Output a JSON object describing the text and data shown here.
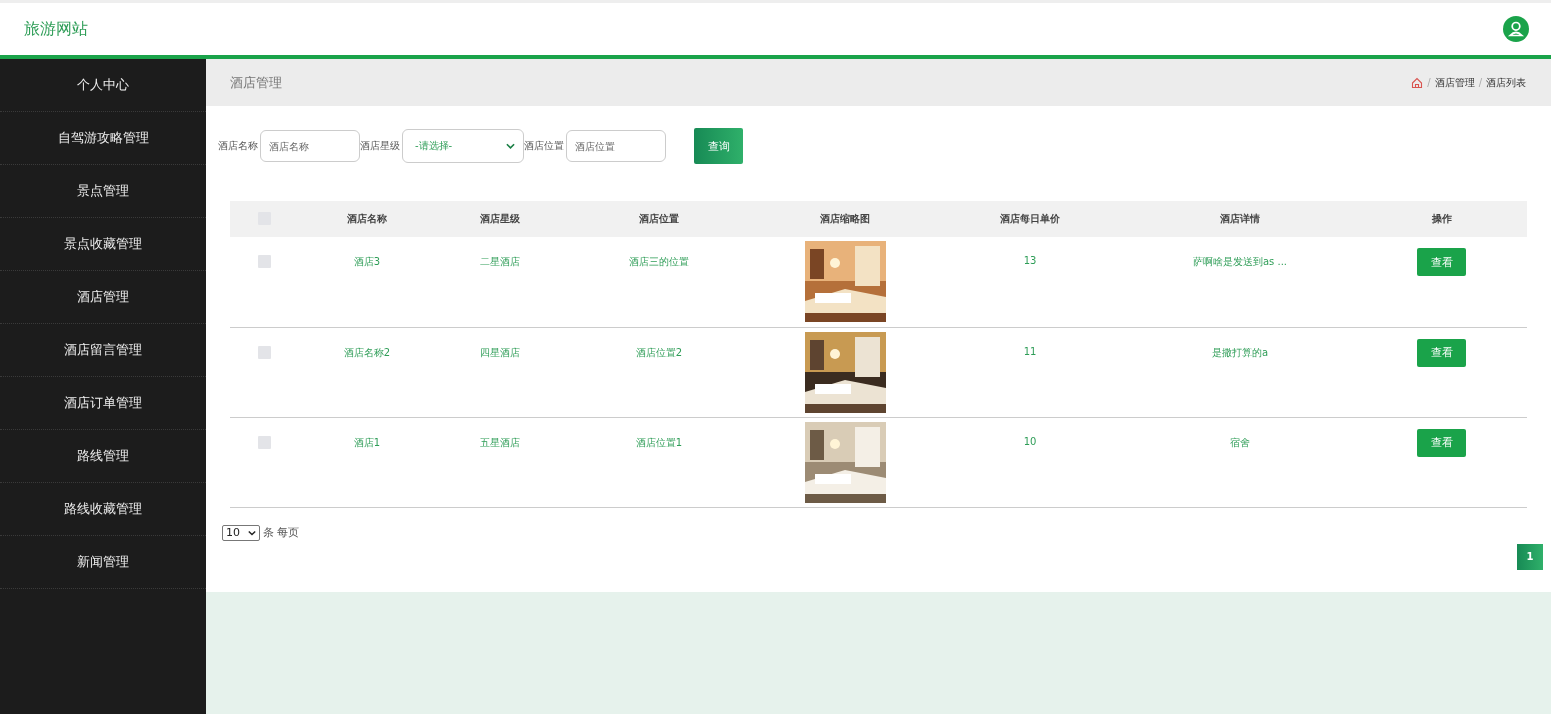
{
  "header": {
    "site_title": "旅游网站"
  },
  "sidebar": {
    "items": [
      {
        "label": "个人中心"
      },
      {
        "label": "自驾游攻略管理"
      },
      {
        "label": "景点管理"
      },
      {
        "label": "景点收藏管理"
      },
      {
        "label": "酒店管理"
      },
      {
        "label": "酒店留言管理"
      },
      {
        "label": "酒店订单管理"
      },
      {
        "label": "路线管理"
      },
      {
        "label": "路线收藏管理"
      },
      {
        "label": "新闻管理"
      }
    ]
  },
  "page_title": "酒店管理",
  "breadcrumb": {
    "separator": "/",
    "items": [
      "酒店管理",
      "酒店列表"
    ]
  },
  "search": {
    "fields": [
      {
        "kind": "input",
        "label": "酒店名称",
        "placeholder": "酒店名称"
      },
      {
        "kind": "select",
        "label": "酒店星级",
        "value": "-请选择-"
      },
      {
        "kind": "input",
        "label": "酒店位置",
        "placeholder": "酒店位置"
      }
    ],
    "button": "查询"
  },
  "table": {
    "columns": [
      "酒店名称",
      "酒店星级",
      "酒店位置",
      "酒店缩略图",
      "酒店每日单价",
      "酒店详情",
      "操作"
    ],
    "header_checked": false,
    "rows": [
      {
        "checked": false,
        "name": "酒店3",
        "stars": "二星酒店",
        "location": "酒店三的位置",
        "price": "13",
        "details": "萨啊啥是发送到as ...",
        "action": "查看"
      },
      {
        "checked": false,
        "name": "酒店名称2",
        "stars": "四星酒店",
        "location": "酒店位置2",
        "price": "11",
        "details": "是撒打算的a",
        "action": "查看"
      },
      {
        "checked": false,
        "name": "酒店1",
        "stars": "五星酒店",
        "location": "酒店位置1",
        "price": "10",
        "details": "宿舍",
        "action": "查看"
      }
    ]
  },
  "pagination": {
    "page_size": "10",
    "page_size_label": "条 每页",
    "pages": [
      {
        "label": "1",
        "selected": true
      }
    ]
  }
}
